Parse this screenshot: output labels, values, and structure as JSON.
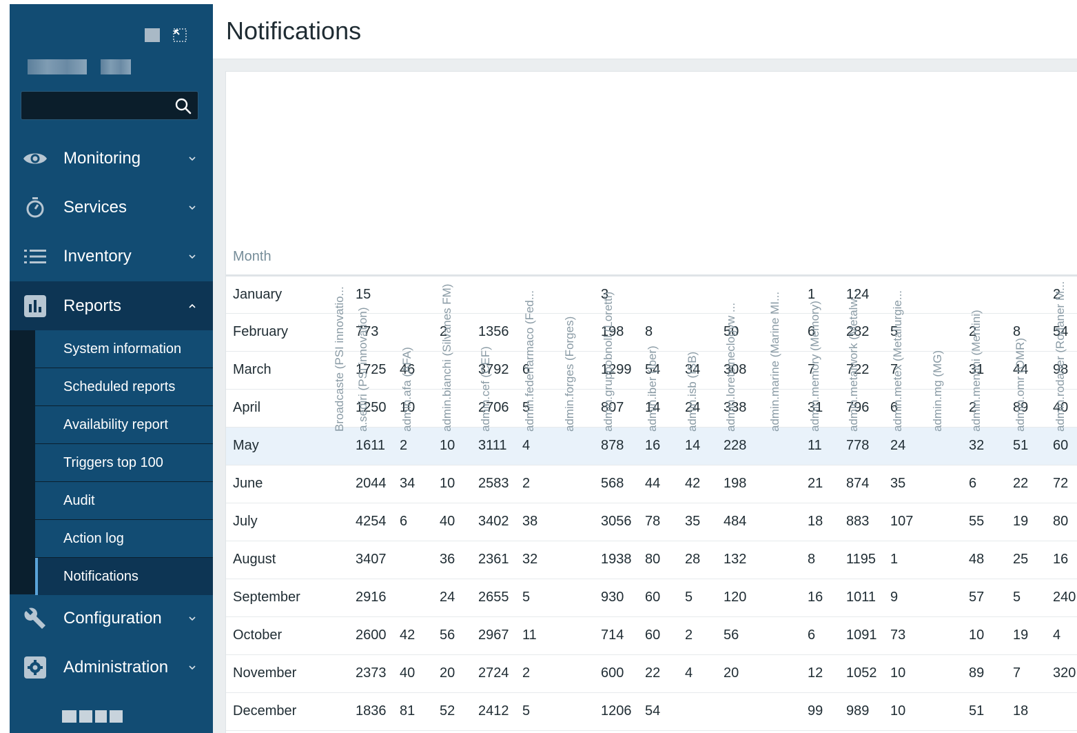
{
  "sidebar": {
    "search": {
      "value": "",
      "placeholder": ""
    },
    "nav": [
      {
        "id": "monitoring",
        "label": "Monitoring",
        "icon": "eye-icon"
      },
      {
        "id": "services",
        "label": "Services",
        "icon": "stopwatch-icon"
      },
      {
        "id": "inventory",
        "label": "Inventory",
        "icon": "list-icon"
      },
      {
        "id": "reports",
        "label": "Reports",
        "icon": "bar-chart-icon"
      },
      {
        "id": "configuration",
        "label": "Configuration",
        "icon": "wrench-icon"
      },
      {
        "id": "administration",
        "label": "Administration",
        "icon": "gear-icon"
      }
    ],
    "reports_submenu": [
      {
        "label": "System information"
      },
      {
        "label": "Scheduled reports"
      },
      {
        "label": "Availability report"
      },
      {
        "label": "Triggers top 100"
      },
      {
        "label": "Audit"
      },
      {
        "label": "Action log"
      },
      {
        "label": "Notifications"
      }
    ]
  },
  "page": {
    "title": "Notifications"
  },
  "table": {
    "month_header": "Month",
    "users": [
      "Broadcastе (PSI innovatio...",
      "a.sediri (PSI innovation)",
      "admin.afa (AFA)",
      "admin.bianchi (Silvanes FM)",
      "admin.cef (CEF)",
      "admin.federfarmaco (Fed...",
      "admin.forges (Forges)",
      "admin.gruppobnoll (Loretti)",
      "admin.iber (Iber)",
      "admin.isb (ISB)",
      "admin.loreteineclogyw ...",
      "admin.marine (Marine MI...",
      "admin.memory (Memory)",
      "admin.metalwork (Metalw...",
      "admin.metex (Metallurgie...",
      "admin.mg (MG)",
      "admin.mentini (Mentini)",
      "admin.omr (OMR)",
      "admin.rodaner (Rodaner M..."
    ],
    "rows": [
      {
        "month": "January",
        "values": [
          "",
          "15",
          "",
          "",
          "",
          "",
          "",
          "3",
          "",
          "",
          "",
          "",
          "1",
          "124",
          "",
          "",
          "",
          "",
          "2"
        ]
      },
      {
        "month": "February",
        "values": [
          "",
          "773",
          "",
          "2",
          "1356",
          "",
          "",
          "198",
          "8",
          "",
          "50",
          "",
          "6",
          "282",
          "5",
          "",
          "2",
          "8",
          "54"
        ]
      },
      {
        "month": "March",
        "values": [
          "",
          "1725",
          "46",
          "",
          "3792",
          "6",
          "",
          "1299",
          "54",
          "34",
          "308",
          "",
          "7",
          "722",
          "7",
          "",
          "31",
          "44",
          "98"
        ]
      },
      {
        "month": "April",
        "values": [
          "",
          "1250",
          "10",
          "",
          "2706",
          "5",
          "",
          "807",
          "14",
          "24",
          "338",
          "",
          "31",
          "796",
          "6",
          "",
          "2",
          "89",
          "40"
        ]
      },
      {
        "month": "May",
        "values": [
          "",
          "1611",
          "2",
          "10",
          "3111",
          "4",
          "",
          "878",
          "16",
          "14",
          "228",
          "",
          "11",
          "778",
          "24",
          "",
          "32",
          "51",
          "60"
        ]
      },
      {
        "month": "June",
        "values": [
          "",
          "2044",
          "34",
          "10",
          "2583",
          "2",
          "",
          "568",
          "44",
          "42",
          "198",
          "",
          "21",
          "874",
          "35",
          "",
          "6",
          "22",
          "72"
        ]
      },
      {
        "month": "July",
        "values": [
          "",
          "4254",
          "6",
          "40",
          "3402",
          "38",
          "",
          "3056",
          "78",
          "35",
          "484",
          "",
          "18",
          "883",
          "107",
          "",
          "55",
          "19",
          "80"
        ]
      },
      {
        "month": "August",
        "values": [
          "",
          "3407",
          "",
          "36",
          "2361",
          "32",
          "",
          "1938",
          "80",
          "28",
          "132",
          "",
          "8",
          "1195",
          "1",
          "",
          "48",
          "25",
          "16"
        ]
      },
      {
        "month": "September",
        "values": [
          "",
          "2916",
          "",
          "24",
          "2655",
          "5",
          "",
          "930",
          "60",
          "5",
          "120",
          "",
          "16",
          "1011",
          "9",
          "",
          "57",
          "5",
          "240"
        ]
      },
      {
        "month": "October",
        "values": [
          "",
          "2600",
          "42",
          "56",
          "2967",
          "11",
          "",
          "714",
          "60",
          "2",
          "56",
          "",
          "6",
          "1091",
          "73",
          "",
          "10",
          "19",
          "4"
        ]
      },
      {
        "month": "November",
        "values": [
          "",
          "2373",
          "40",
          "20",
          "2724",
          "2",
          "",
          "600",
          "22",
          "4",
          "20",
          "",
          "12",
          "1052",
          "10",
          "",
          "89",
          "7",
          "320"
        ]
      },
      {
        "month": "December",
        "values": [
          "",
          "1836",
          "81",
          "52",
          "2412",
          "5",
          "",
          "1206",
          "54",
          "",
          "",
          "",
          "99",
          "989",
          "10",
          "",
          "51",
          "18",
          ""
        ]
      }
    ],
    "highlighted_row": "May"
  },
  "colors": {
    "sidebar_bg": "#124c73",
    "sidebar_active": "#0d3554",
    "highlight_row": "#e9f2fa",
    "selected_indicator": "#5aa3d9"
  }
}
